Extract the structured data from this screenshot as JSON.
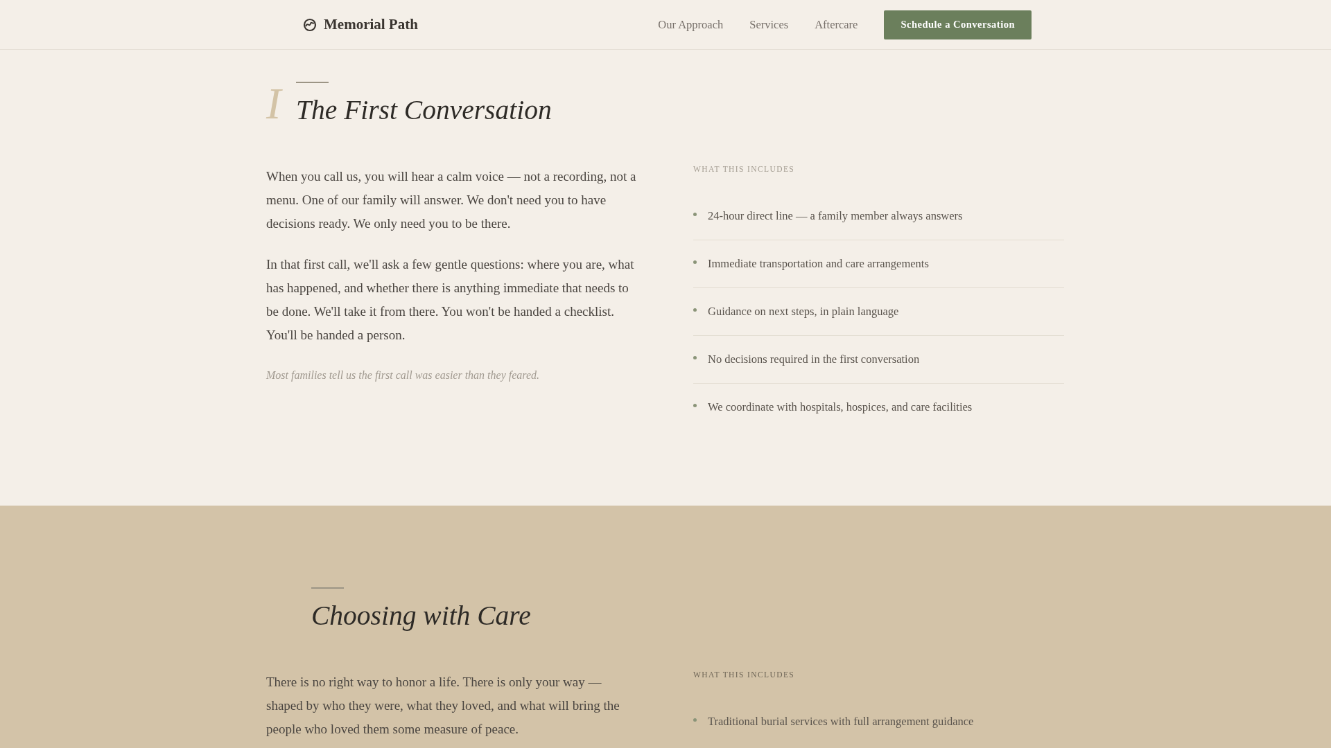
{
  "header": {
    "brand": "Memorial Path",
    "nav": [
      {
        "label": "Our Approach"
      },
      {
        "label": "Services"
      },
      {
        "label": "Aftercare"
      }
    ],
    "cta": "Schedule a Conversation"
  },
  "sections": [
    {
      "numeral": "I",
      "title": "The First Conversation",
      "paragraphs": [
        "When you call us, you will hear a calm voice — not a recording, not a menu. One of our family will answer. We don't need you to have decisions ready. We only need you to be there.",
        "In that first call, we'll ask a few gentle questions: where you are, what has happened, and whether there is anything immediate that needs to be done. We'll take it from there. You won't be handed a checklist. You'll be handed a person."
      ],
      "note": "Most families tell us the first call was easier than they feared.",
      "includes_label": "WHAT THIS INCLUDES",
      "includes": [
        "24-hour direct line — a family member always answers",
        "Immediate transportation and care arrangements",
        "Guidance on next steps, in plain language",
        "No decisions required in the first conversation",
        "We coordinate with hospitals, hospices, and care facilities"
      ]
    },
    {
      "title": "Choosing with Care",
      "paragraphs": [
        "There is no right way to honor a life. There is only your way — shaped by who they were, what they loved, and what will bring the people who loved them some measure of peace."
      ],
      "includes_label": "WHAT THIS INCLUDES",
      "includes": [
        "Traditional burial services with full arrangement guidance"
      ]
    }
  ]
}
